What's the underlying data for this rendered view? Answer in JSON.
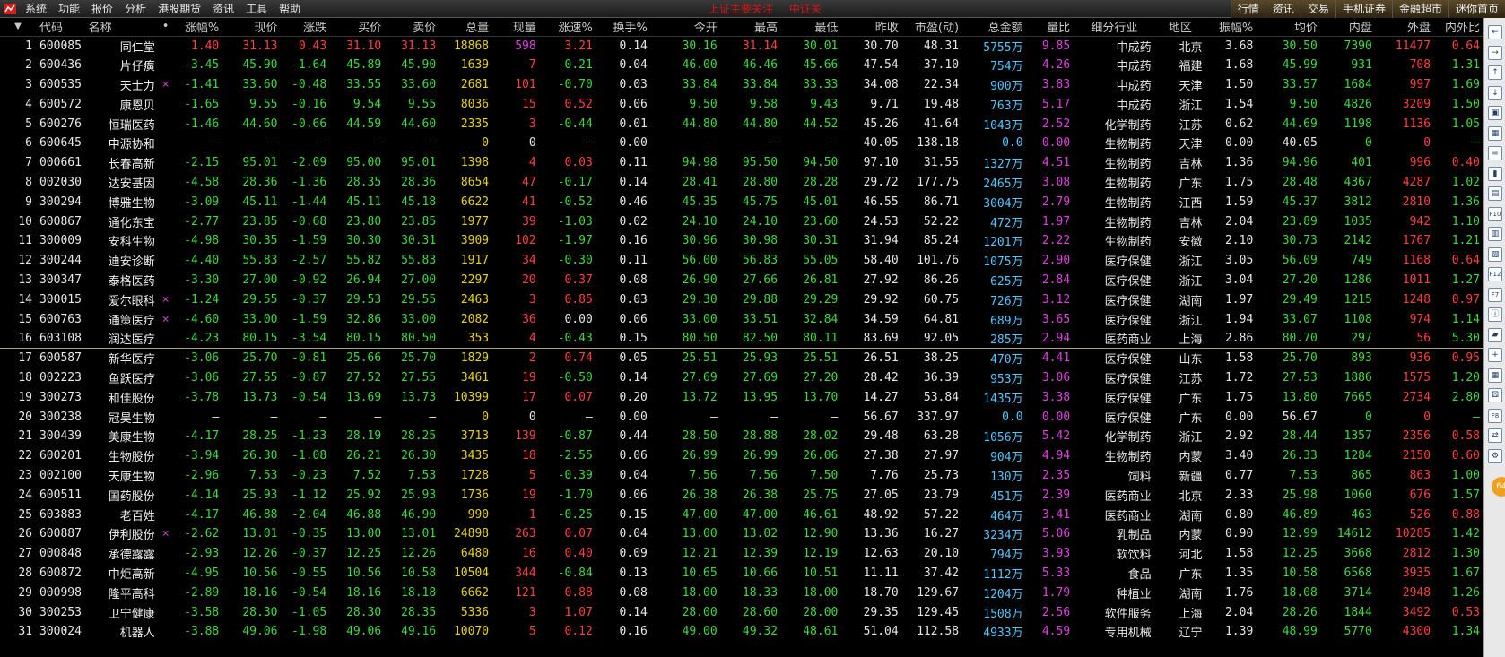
{
  "menu": {
    "items": [
      "系统",
      "功能",
      "报价",
      "分析",
      "港股期货",
      "资讯",
      "工具",
      "帮助"
    ],
    "center_title": [
      "上证主要关注",
      "中证关"
    ],
    "right_buttons": [
      "行情",
      "资讯",
      "交易",
      "手机证券",
      "金融超市",
      "迷你首页"
    ]
  },
  "table": {
    "headers": [
      "",
      "代码",
      "名称",
      "•",
      "涨幅%",
      "现价",
      "涨跌",
      "买价",
      "卖价",
      "总量",
      "现量",
      "涨速%",
      "换手%",
      "今开",
      "最高",
      "最低",
      "昨收",
      "市盈(动)",
      "总金额",
      "量比",
      "细分行业",
      "地区",
      "振幅%",
      "均价",
      "内盘",
      "外盘",
      "内外比"
    ],
    "rows": [
      [
        "1",
        "600085",
        "同仁堂",
        "",
        "1.40",
        "31.13",
        "0.43",
        "31.10",
        "31.13",
        "18868",
        "598",
        "3.21",
        "0.14",
        "30.16",
        "31.14",
        "30.01",
        "30.70",
        "48.31",
        "5755",
        "9.85",
        "中成药",
        "北京",
        "3.68",
        "30.50",
        "7390",
        "11477",
        "0.64"
      ],
      [
        "2",
        "600436",
        "片仔癀",
        "",
        "-3.45",
        "45.90",
        "-1.64",
        "45.89",
        "45.90",
        "1639",
        "7",
        "-0.21",
        "0.04",
        "46.00",
        "46.46",
        "45.66",
        "47.54",
        "37.10",
        "754",
        "4.26",
        "中成药",
        "福建",
        "1.68",
        "45.99",
        "931",
        "708",
        "1.31"
      ],
      [
        "3",
        "600535",
        "天士力",
        "×",
        "-1.41",
        "33.60",
        "-0.48",
        "33.55",
        "33.60",
        "2681",
        "101",
        "-0.70",
        "0.03",
        "33.84",
        "33.84",
        "33.33",
        "34.08",
        "22.34",
        "900",
        "3.83",
        "中成药",
        "天津",
        "1.50",
        "33.57",
        "1684",
        "997",
        "1.69"
      ],
      [
        "4",
        "600572",
        "康恩贝",
        "",
        "-1.65",
        "9.55",
        "-0.16",
        "9.54",
        "9.55",
        "8036",
        "15",
        "0.52",
        "0.06",
        "9.50",
        "9.58",
        "9.43",
        "9.71",
        "19.48",
        "763",
        "5.17",
        "中成药",
        "浙江",
        "1.54",
        "9.50",
        "4826",
        "3209",
        "1.50"
      ],
      [
        "5",
        "600276",
        "恒瑞医药",
        "",
        "-1.46",
        "44.60",
        "-0.66",
        "44.59",
        "44.60",
        "2335",
        "3",
        "-0.44",
        "0.01",
        "44.80",
        "44.80",
        "44.52",
        "45.26",
        "41.64",
        "1043",
        "2.52",
        "化学制药",
        "江苏",
        "0.62",
        "44.69",
        "1198",
        "1136",
        "1.05"
      ],
      [
        "6",
        "600645",
        "中源协和",
        "",
        "—",
        "—",
        "—",
        "—",
        "—",
        "0",
        "0",
        "—",
        "0.00",
        "—",
        "—",
        "—",
        "40.05",
        "138.18",
        "0.0",
        "0.00",
        "生物制药",
        "天津",
        "0.00",
        "40.05",
        "0",
        "0",
        "—"
      ],
      [
        "7",
        "000661",
        "长春高新",
        "",
        "-2.15",
        "95.01",
        "-2.09",
        "95.00",
        "95.01",
        "1398",
        "4",
        "0.03",
        "0.11",
        "94.98",
        "95.50",
        "94.50",
        "97.10",
        "31.55",
        "1327",
        "4.51",
        "生物制药",
        "吉林",
        "1.36",
        "94.96",
        "401",
        "996",
        "0.40"
      ],
      [
        "8",
        "002030",
        "达安基因",
        "",
        "-4.58",
        "28.36",
        "-1.36",
        "28.35",
        "28.36",
        "8654",
        "47",
        "-0.17",
        "0.14",
        "28.41",
        "28.80",
        "28.28",
        "29.72",
        "177.75",
        "2465",
        "3.08",
        "生物制药",
        "广东",
        "1.75",
        "28.48",
        "4367",
        "4287",
        "1.02"
      ],
      [
        "9",
        "300294",
        "博雅生物",
        "",
        "-3.09",
        "45.11",
        "-1.44",
        "45.11",
        "45.18",
        "6622",
        "41",
        "-0.52",
        "0.46",
        "45.35",
        "45.75",
        "45.01",
        "46.55",
        "86.71",
        "3004",
        "2.79",
        "生物制药",
        "江西",
        "1.59",
        "45.37",
        "3812",
        "2810",
        "1.36"
      ],
      [
        "10",
        "600867",
        "通化东宝",
        "",
        "-2.77",
        "23.85",
        "-0.68",
        "23.80",
        "23.85",
        "1977",
        "39",
        "-1.03",
        "0.02",
        "24.10",
        "24.10",
        "23.60",
        "24.53",
        "52.22",
        "472",
        "1.97",
        "生物制药",
        "吉林",
        "2.04",
        "23.89",
        "1035",
        "942",
        "1.10"
      ],
      [
        "11",
        "300009",
        "安科生物",
        "",
        "-4.98",
        "30.35",
        "-1.59",
        "30.30",
        "30.31",
        "3909",
        "102",
        "-1.97",
        "0.16",
        "30.96",
        "30.98",
        "30.31",
        "31.94",
        "85.24",
        "1201",
        "2.22",
        "生物制药",
        "安徽",
        "2.10",
        "30.73",
        "2142",
        "1767",
        "1.21"
      ],
      [
        "12",
        "300244",
        "迪安诊断",
        "",
        "-4.40",
        "55.83",
        "-2.57",
        "55.82",
        "55.83",
        "1917",
        "34",
        "-0.30",
        "0.11",
        "56.00",
        "56.83",
        "55.05",
        "58.40",
        "101.76",
        "1075",
        "2.90",
        "医疗保健",
        "浙江",
        "3.05",
        "56.09",
        "749",
        "1168",
        "0.64"
      ],
      [
        "13",
        "300347",
        "泰格医药",
        "",
        "-3.30",
        "27.00",
        "-0.92",
        "26.94",
        "27.00",
        "2297",
        "20",
        "0.37",
        "0.08",
        "26.90",
        "27.66",
        "26.81",
        "27.92",
        "86.26",
        "625",
        "2.84",
        "医疗保健",
        "浙江",
        "3.04",
        "27.20",
        "1286",
        "1011",
        "1.27"
      ],
      [
        "14",
        "300015",
        "爱尔眼科",
        "×",
        "-1.24",
        "29.55",
        "-0.37",
        "29.53",
        "29.55",
        "2463",
        "3",
        "0.85",
        "0.03",
        "29.30",
        "29.88",
        "29.29",
        "29.92",
        "60.75",
        "726",
        "3.12",
        "医疗保健",
        "湖南",
        "1.97",
        "29.49",
        "1215",
        "1248",
        "0.97"
      ],
      [
        "15",
        "600763",
        "通策医疗",
        "×",
        "-4.60",
        "33.00",
        "-1.59",
        "32.86",
        "33.00",
        "2082",
        "36",
        "0.00",
        "0.06",
        "33.00",
        "33.51",
        "32.84",
        "34.59",
        "64.81",
        "689",
        "3.65",
        "医疗保健",
        "浙江",
        "1.94",
        "33.07",
        "1108",
        "974",
        "1.14"
      ],
      [
        "16",
        "603108",
        "润达医疗",
        "",
        "-4.23",
        "80.15",
        "-3.54",
        "80.15",
        "80.50",
        "353",
        "4",
        "-0.43",
        "0.15",
        "80.50",
        "82.50",
        "80.11",
        "83.69",
        "92.05",
        "285",
        "2.94",
        "医药商业",
        "上海",
        "2.86",
        "80.70",
        "297",
        "56",
        "5.30"
      ],
      [
        "17",
        "600587",
        "新华医疗",
        "",
        "-3.06",
        "25.70",
        "-0.81",
        "25.66",
        "25.70",
        "1829",
        "2",
        "0.74",
        "0.05",
        "25.51",
        "25.93",
        "25.51",
        "26.51",
        "38.25",
        "470",
        "4.41",
        "医疗保健",
        "山东",
        "1.58",
        "25.70",
        "893",
        "936",
        "0.95"
      ],
      [
        "18",
        "002223",
        "鱼跃医疗",
        "",
        "-3.06",
        "27.55",
        "-0.87",
        "27.52",
        "27.55",
        "3461",
        "19",
        "-0.50",
        "0.14",
        "27.69",
        "27.69",
        "27.20",
        "28.42",
        "36.39",
        "953",
        "3.06",
        "医疗保健",
        "江苏",
        "1.72",
        "27.53",
        "1886",
        "1575",
        "1.20"
      ],
      [
        "19",
        "300273",
        "和佳股份",
        "",
        "-3.78",
        "13.73",
        "-0.54",
        "13.69",
        "13.73",
        "10399",
        "17",
        "0.07",
        "0.20",
        "13.72",
        "13.95",
        "13.70",
        "14.27",
        "53.84",
        "1435",
        "3.38",
        "医疗保健",
        "广东",
        "1.75",
        "13.80",
        "7665",
        "2734",
        "2.80"
      ],
      [
        "20",
        "300238",
        "冠昊生物",
        "",
        "—",
        "—",
        "—",
        "—",
        "—",
        "0",
        "0",
        "—",
        "0.00",
        "—",
        "—",
        "—",
        "56.67",
        "337.97",
        "0.0",
        "0.00",
        "医疗保健",
        "广东",
        "0.00",
        "56.67",
        "0",
        "0",
        "—"
      ],
      [
        "21",
        "300439",
        "美康生物",
        "",
        "-4.17",
        "28.25",
        "-1.23",
        "28.19",
        "28.25",
        "3713",
        "139",
        "-0.87",
        "0.44",
        "28.50",
        "28.88",
        "28.02",
        "29.48",
        "63.28",
        "1056",
        "5.42",
        "化学制药",
        "浙江",
        "2.92",
        "28.44",
        "1357",
        "2356",
        "0.58"
      ],
      [
        "22",
        "600201",
        "生物股份",
        "",
        "-3.94",
        "26.30",
        "-1.08",
        "26.21",
        "26.30",
        "3435",
        "18",
        "-2.55",
        "0.06",
        "26.99",
        "26.99",
        "26.06",
        "27.38",
        "27.97",
        "904",
        "4.94",
        "生物制药",
        "内蒙",
        "3.40",
        "26.33",
        "1284",
        "2150",
        "0.60"
      ],
      [
        "23",
        "002100",
        "天康生物",
        "",
        "-2.96",
        "7.53",
        "-0.23",
        "7.52",
        "7.53",
        "1728",
        "5",
        "-0.39",
        "0.04",
        "7.56",
        "7.56",
        "7.50",
        "7.76",
        "25.73",
        "130",
        "2.35",
        "饲料",
        "新疆",
        "0.77",
        "7.53",
        "865",
        "863",
        "1.00"
      ],
      [
        "24",
        "600511",
        "国药股份",
        "",
        "-4.14",
        "25.93",
        "-1.12",
        "25.92",
        "25.93",
        "1736",
        "19",
        "-1.70",
        "0.06",
        "26.38",
        "26.38",
        "25.75",
        "27.05",
        "23.79",
        "451",
        "2.39",
        "医药商业",
        "北京",
        "2.33",
        "25.98",
        "1060",
        "676",
        "1.57"
      ],
      [
        "25",
        "603883",
        "老百姓",
        "",
        "-4.17",
        "46.88",
        "-2.04",
        "46.88",
        "46.90",
        "990",
        "1",
        "-0.25",
        "0.15",
        "47.00",
        "47.00",
        "46.61",
        "48.92",
        "57.22",
        "464",
        "3.41",
        "医药商业",
        "湖南",
        "0.80",
        "46.89",
        "463",
        "526",
        "0.88"
      ],
      [
        "26",
        "600887",
        "伊利股份",
        "×",
        "-2.62",
        "13.01",
        "-0.35",
        "13.00",
        "13.01",
        "24898",
        "263",
        "0.07",
        "0.04",
        "13.00",
        "13.02",
        "12.90",
        "13.36",
        "16.27",
        "3234",
        "5.06",
        "乳制品",
        "内蒙",
        "0.90",
        "12.99",
        "14612",
        "10285",
        "1.42"
      ],
      [
        "27",
        "000848",
        "承德露露",
        "",
        "-2.93",
        "12.26",
        "-0.37",
        "12.25",
        "12.26",
        "6480",
        "16",
        "0.40",
        "0.09",
        "12.21",
        "12.39",
        "12.19",
        "12.63",
        "20.10",
        "794",
        "3.93",
        "软饮料",
        "河北",
        "1.58",
        "12.25",
        "3668",
        "2812",
        "1.30"
      ],
      [
        "28",
        "600872",
        "中炬高新",
        "",
        "-4.95",
        "10.56",
        "-0.55",
        "10.56",
        "10.58",
        "10504",
        "344",
        "-0.84",
        "0.13",
        "10.65",
        "10.66",
        "10.51",
        "11.11",
        "37.42",
        "1112",
        "5.33",
        "食品",
        "广东",
        "1.35",
        "10.58",
        "6568",
        "3935",
        "1.67"
      ],
      [
        "29",
        "000998",
        "隆平高科",
        "",
        "-2.89",
        "18.16",
        "-0.54",
        "18.16",
        "18.18",
        "6662",
        "121",
        "0.88",
        "0.08",
        "18.00",
        "18.33",
        "18.00",
        "18.70",
        "129.67",
        "1204",
        "1.79",
        "种植业",
        "湖南",
        "1.76",
        "18.08",
        "3714",
        "2948",
        "1.26"
      ],
      [
        "30",
        "300253",
        "卫宁健康",
        "",
        "-3.58",
        "28.30",
        "-1.05",
        "28.30",
        "28.35",
        "5336",
        "3",
        "1.07",
        "0.14",
        "28.00",
        "28.60",
        "28.00",
        "29.35",
        "129.45",
        "1508",
        "2.56",
        "软件服务",
        "上海",
        "2.04",
        "28.26",
        "1844",
        "3492",
        "0.53"
      ],
      [
        "31",
        "300024",
        "机器人",
        "",
        "-3.88",
        "49.06",
        "-1.98",
        "49.06",
        "49.16",
        "10070",
        "5",
        "0.12",
        "0.16",
        "49.00",
        "49.32",
        "48.61",
        "51.04",
        "112.58",
        "4933",
        "4.59",
        "专用机械",
        "辽宁",
        "1.39",
        "48.99",
        "5770",
        "4300",
        "1.34"
      ]
    ],
    "amount_unit": "万",
    "separator_after_row": 16
  },
  "colors": {
    "up": "#ff4040",
    "down": "#3fd83f",
    "flat": "#e6e6e6",
    "volume": "#e8d400",
    "amount": "#4fc7ff",
    "ratio": "#e040e0",
    "accent": "#c08040"
  },
  "sidebar": {
    "icons": [
      "arrow-left-icon",
      "arrow-right-icon",
      "arrow-up-icon",
      "arrow-down-icon",
      "window-icon",
      "chart-icon",
      "list-icon",
      "candle-icon",
      "grid-icon",
      "f10-icon",
      "book-icon",
      "doc-icon",
      "f12-icon",
      "f7-icon",
      "info-icon",
      "folder-icon",
      "plus-icon",
      "table-icon",
      "dice-icon",
      "f8-icon",
      "trade-icon",
      "gear-icon"
    ],
    "badge": "64"
  }
}
